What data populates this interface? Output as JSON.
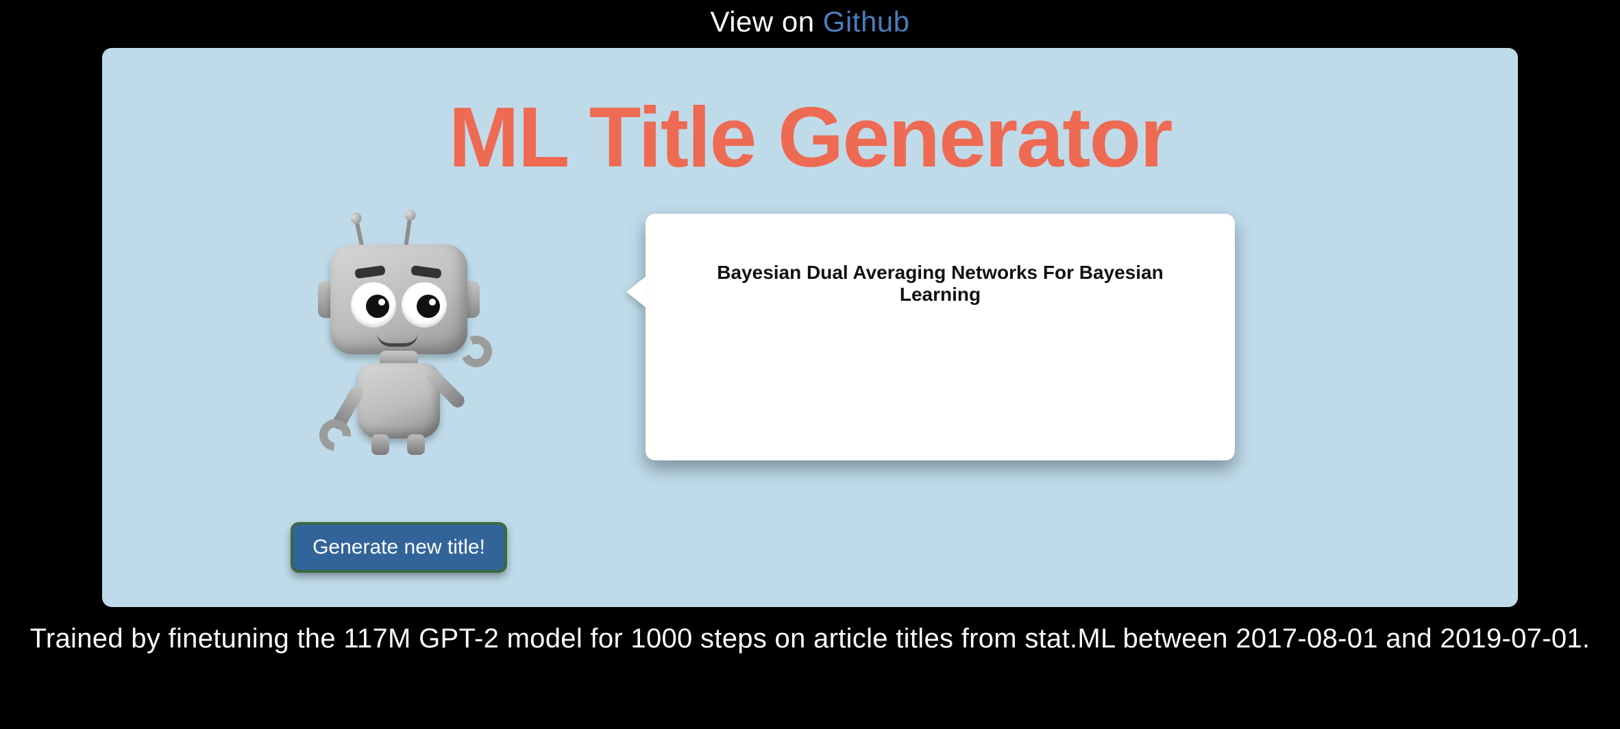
{
  "header": {
    "prefix": "View on ",
    "link_label": "Github"
  },
  "card": {
    "title": "ML Title Generator",
    "generated_title": "Bayesian Dual Averaging Networks For Bayesian Learning",
    "button_label": "Generate new title!"
  },
  "footer": {
    "text": "Trained by finetuning the 117M GPT-2 model for 1000 steps on article titles from stat.ML between 2017-08-01 and 2019-07-01."
  },
  "colors": {
    "accent": "#ee6a52",
    "card_bg": "#bfdbea",
    "link": "#4a7dbd",
    "button_bg": "#32649a",
    "button_border": "#3a6a3f"
  }
}
